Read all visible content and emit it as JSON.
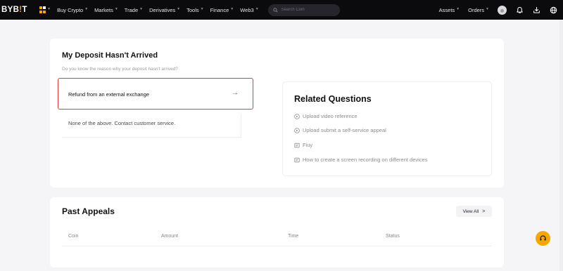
{
  "header": {
    "logo_text": "BYB",
    "logo_tick": "!",
    "logo_tail": "T",
    "nav": [
      "Buy Crypto",
      "Markets",
      "Trade",
      "Derivatives",
      "Tools",
      "Finance",
      "Web3"
    ],
    "search_placeholder": "Search Coin",
    "right": [
      "Assets",
      "Orders"
    ],
    "icons": [
      "avatar",
      "bell-icon",
      "download-icon",
      "globe-icon"
    ]
  },
  "deposit": {
    "title": "My Deposit Hasn't Arrived",
    "subtitle": "Do you know the reason why your deposit hasn't arrived?",
    "options": [
      {
        "label": "Refund from an external exchange",
        "arrow": "→",
        "selected": true
      },
      {
        "label": "None of the above. Contact customer service.",
        "selected": false
      }
    ]
  },
  "related": {
    "title": "Related Questions",
    "items": [
      {
        "text": "Upload video reference",
        "icon": "play-circle-icon"
      },
      {
        "text": "Upload submit a self-service appeal",
        "icon": "play-circle-icon"
      },
      {
        "text": "Fiuy",
        "icon": "document-icon"
      },
      {
        "text": "How to create a screen recording on different devices",
        "icon": "document-icon"
      }
    ]
  },
  "appeals": {
    "title": "Past Appeals",
    "view_all": "View All",
    "view_all_chevron": ">",
    "columns": [
      "Coin",
      "Amount",
      "Time",
      "Status"
    ]
  },
  "colors": {
    "accent": "#f7a600",
    "highlight_border": "#e03b3b",
    "topbar": "#0b0b0e"
  }
}
